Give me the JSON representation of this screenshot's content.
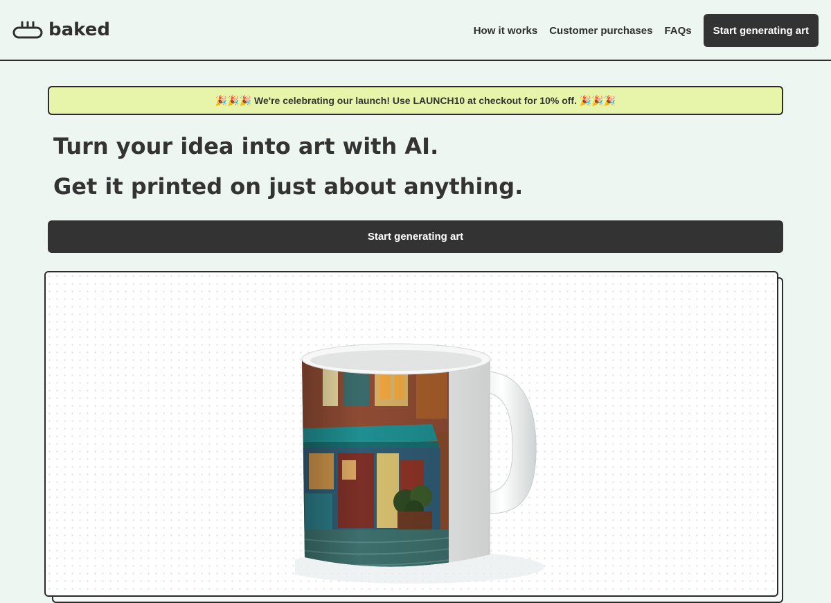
{
  "header": {
    "logo_text": "baked",
    "nav": [
      {
        "label": "How it works"
      },
      {
        "label": "Customer purchases"
      },
      {
        "label": "FAQs"
      }
    ],
    "cta_label": "Start generating art"
  },
  "banner": {
    "text": "🎉🎉🎉 We're celebrating our launch! Use LAUNCH10 at checkout for 10% off. 🎉🎉🎉"
  },
  "hero": {
    "line1": "Turn your idea into art with AI.",
    "line2": "Get it printed on just about anything.",
    "cta_label": "Start generating art"
  },
  "product_preview": {
    "icon": "mug-icon"
  },
  "colors": {
    "background": "#edf6f1",
    "dark": "#333333",
    "banner": "#e6f5a9",
    "accent_teal": "#1f8f91"
  }
}
